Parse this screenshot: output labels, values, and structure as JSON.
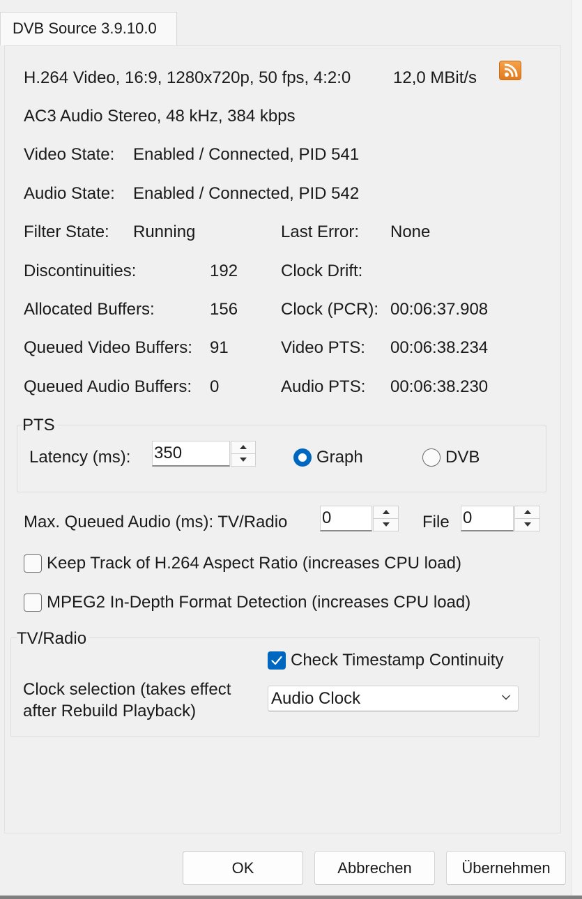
{
  "window": {
    "tab_label": "DVB Source 3.9.10.0"
  },
  "stream_info": {
    "video_line": "H.264 Video, 16:9, 1280x720p, 50 fps, 4:2:0",
    "bitrate": "12,0 MBit/s",
    "audio_line": "AC3 Audio Stereo, 48 kHz, 384 kbps",
    "rss_icon": "rss-icon"
  },
  "state": {
    "video_state_label": "Video State:",
    "video_state_value": "Enabled / Connected, PID 541",
    "audio_state_label": "Audio State:",
    "audio_state_value": "Enabled / Connected, PID 542",
    "filter_state_label": "Filter State:",
    "filter_state_value": "Running"
  },
  "stats_left": [
    {
      "label": "Discontinuities:",
      "value": "192"
    },
    {
      "label": "Allocated Buffers:",
      "value": "156"
    },
    {
      "label": "Queued Video Buffers:",
      "value": "91"
    },
    {
      "label": "Queued Audio Buffers:",
      "value": "0"
    }
  ],
  "stats_right": [
    {
      "label": "Last Error:",
      "value": "None"
    },
    {
      "label": "Clock Drift:",
      "value": ""
    },
    {
      "label": "Clock (PCR):",
      "value": "00:06:37.908"
    },
    {
      "label": "Video PTS:",
      "value": "00:06:38.234"
    },
    {
      "label": "Audio PTS:",
      "value": "00:06:38.230"
    }
  ],
  "pts_group": {
    "title": "PTS",
    "latency_label": "Latency (ms):",
    "latency_value": "350",
    "radio_graph_label": "Graph",
    "radio_dvb_label": "DVB",
    "selected": "Graph"
  },
  "queued_audio": {
    "label": "Max. Queued Audio (ms): TV/Radio",
    "tv_radio_value": "0",
    "file_label": "File",
    "file_value": "0"
  },
  "options": {
    "keep_track_label": "Keep Track of H.264 Aspect Ratio (increases CPU load)",
    "keep_track_checked": false,
    "mpeg2_label": "MPEG2 In-Depth Format Detection (increases CPU load)",
    "mpeg2_checked": false
  },
  "tv_radio_group": {
    "title": "TV/Radio",
    "check_timestamp_label": "Check Timestamp Continuity",
    "check_timestamp_checked": true,
    "clock_selection_line1": "Clock selection (takes effect",
    "clock_selection_line2": "after Rebuild Playback)",
    "clock_value": "Audio Clock"
  },
  "footer": {
    "ok_label": "OK",
    "cancel_label": "Abbrechen",
    "apply_label": "Übernehmen"
  },
  "colors": {
    "accent": "#0067c0",
    "background": "#f0f0f0",
    "rss_orange": "#e88a2c"
  }
}
